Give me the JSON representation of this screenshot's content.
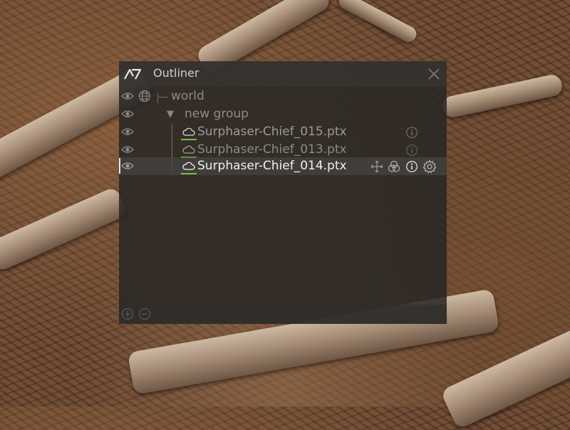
{
  "window": {
    "title": "Outliner"
  },
  "tree": {
    "world": {
      "label": "world"
    },
    "group": {
      "label": "new group",
      "toggle": "▼"
    },
    "items": [
      {
        "label": "Surphaser-Chief_015.ptx",
        "selected": false
      },
      {
        "label": "Surphaser-Chief_013.ptx",
        "selected": false
      },
      {
        "label": "Surphaser-Chief_014.ptx",
        "selected": true
      }
    ]
  },
  "icons": {
    "visibility": "eye-icon",
    "world": "globe-icon",
    "pointcloud": "cloud-icon",
    "info": "info-icon",
    "move": "move-icon",
    "color": "color-channels-icon",
    "settings": "gear-icon",
    "add": "plus-icon",
    "remove": "minus-icon",
    "close": "close-icon"
  },
  "colors": {
    "accent_underline": "#6cc04a",
    "text_bright": "#f0f0f0",
    "text_dim": "#8a8a8a"
  }
}
